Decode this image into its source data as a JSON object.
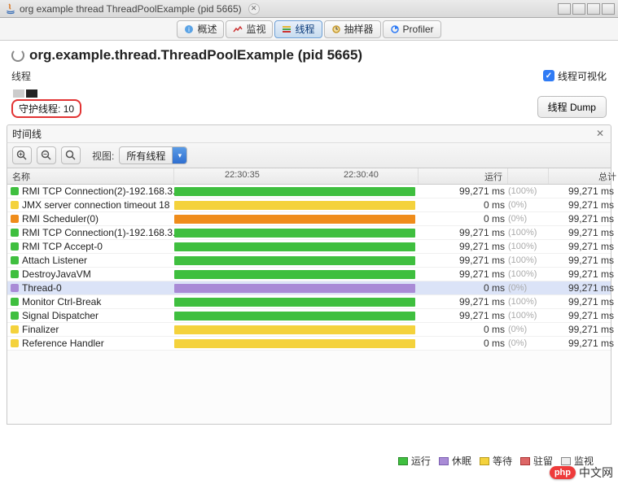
{
  "window": {
    "title": "org example thread ThreadPoolExample (pid 5665)"
  },
  "tabs": [
    {
      "label": "概述",
      "icon": "info-icon"
    },
    {
      "label": "监视",
      "icon": "monitor-icon"
    },
    {
      "label": "线程",
      "icon": "threads-icon",
      "active": true
    },
    {
      "label": "抽样器",
      "icon": "sampler-icon"
    },
    {
      "label": "Profiler",
      "icon": "profiler-icon"
    }
  ],
  "header": {
    "title": "org.example.thread.ThreadPoolExample (pid 5665)"
  },
  "subheader": {
    "label": "线程",
    "checkbox_label": "线程可视化"
  },
  "daemon": {
    "label": "守护线程:",
    "count": "10",
    "dump_button": "线程 Dump"
  },
  "timeline": {
    "title": "时间线",
    "view_label": "视图:",
    "filter_selected": "所有线程",
    "ticks": [
      "22:30:35",
      "22:30:40"
    ]
  },
  "columns": {
    "name": "名称",
    "run": "运行",
    "total": "总计"
  },
  "threads": [
    {
      "name": "RMI TCP Connection(2)-192.168.3.",
      "color": "green",
      "bar": "green",
      "run_ms": "99,271 ms",
      "pct": "(100%)",
      "total_ms": "99,271 ms"
    },
    {
      "name": "JMX server connection timeout 18",
      "color": "yellow",
      "bar": "yellow",
      "run_ms": "0 ms",
      "pct": "(0%)",
      "total_ms": "99,271 ms"
    },
    {
      "name": "RMI Scheduler(0)",
      "color": "orange",
      "bar": "orange",
      "run_ms": "0 ms",
      "pct": "(0%)",
      "total_ms": "99,271 ms"
    },
    {
      "name": "RMI TCP Connection(1)-192.168.3.",
      "color": "green",
      "bar": "green",
      "run_ms": "99,271 ms",
      "pct": "(100%)",
      "total_ms": "99,271 ms"
    },
    {
      "name": "RMI TCP Accept-0",
      "color": "green",
      "bar": "green",
      "run_ms": "99,271 ms",
      "pct": "(100%)",
      "total_ms": "99,271 ms"
    },
    {
      "name": "Attach Listener",
      "color": "green",
      "bar": "green",
      "run_ms": "99,271 ms",
      "pct": "(100%)",
      "total_ms": "99,271 ms"
    },
    {
      "name": "DestroyJavaVM",
      "color": "green",
      "bar": "green",
      "run_ms": "99,271 ms",
      "pct": "(100%)",
      "total_ms": "99,271 ms"
    },
    {
      "name": "Thread-0",
      "color": "purple",
      "bar": "purple",
      "run_ms": "0 ms",
      "pct": "(0%)",
      "total_ms": "99,271 ms",
      "selected": true
    },
    {
      "name": "Monitor Ctrl-Break",
      "color": "green",
      "bar": "green",
      "run_ms": "99,271 ms",
      "pct": "(100%)",
      "total_ms": "99,271 ms"
    },
    {
      "name": "Signal Dispatcher",
      "color": "green",
      "bar": "green",
      "run_ms": "99,271 ms",
      "pct": "(100%)",
      "total_ms": "99,271 ms"
    },
    {
      "name": "Finalizer",
      "color": "yellow",
      "bar": "yellow",
      "run_ms": "0 ms",
      "pct": "(0%)",
      "total_ms": "99,271 ms"
    },
    {
      "name": "Reference Handler",
      "color": "yellow",
      "bar": "yellow",
      "run_ms": "0 ms",
      "pct": "(0%)",
      "total_ms": "99,271 ms"
    }
  ],
  "legend": {
    "running": "运行",
    "sleeping": "休眠",
    "waiting": "等待",
    "parked": "驻留",
    "monitor": "监视"
  },
  "watermark": {
    "logo": "php",
    "text": "中文网"
  }
}
